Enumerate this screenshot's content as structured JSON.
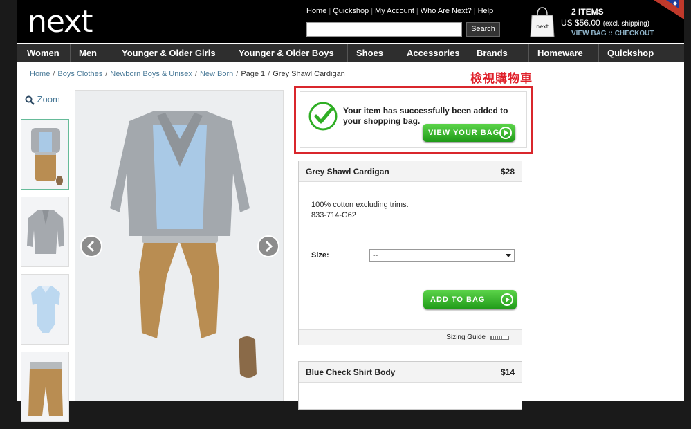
{
  "header": {
    "logo": "next",
    "links": [
      "Home",
      "Quickshop",
      "My Account",
      "Who Are Next?",
      "Help"
    ],
    "search": {
      "placeholder": "",
      "button": "Search"
    },
    "bag": {
      "count": "2 ITEMS",
      "price": "US $56.00",
      "price_note": "(excl. shipping)",
      "links": "VIEW BAG :: CHECKOUT",
      "bag_logo": "next"
    }
  },
  "nav": [
    "Women",
    "Men",
    "Younger & Older Girls",
    "Younger & Older Boys",
    "Shoes",
    "Accessories",
    "Brands",
    "Homeware",
    "Quickshop"
  ],
  "breadcrumb": {
    "links": [
      "Home",
      "Boys Clothes",
      "Newborn Boys & Unisex",
      "New Born"
    ],
    "page": "Page 1",
    "current": "Grey Shawl Cardigan"
  },
  "annotation": "檢視購物車",
  "zoom": "Zoom",
  "notice": {
    "text": "Your item has successfully been added to your shopping bag.",
    "button": "VIEW YOUR BAG"
  },
  "products": [
    {
      "name": "Grey Shawl Cardigan",
      "price": "$28",
      "desc1": "100% cotton excluding trims.",
      "desc2": "833-714-G62",
      "size_label": "Size:",
      "size_value": "--",
      "add_button": "ADD TO BAG",
      "sizing_guide": "Sizing Guide"
    },
    {
      "name": "Blue Check Shirt Body",
      "price": "$14"
    }
  ],
  "colors": {
    "accent_green": "#2fae24",
    "highlight_red": "#d9262c",
    "link_blue": "#4a7a98"
  }
}
